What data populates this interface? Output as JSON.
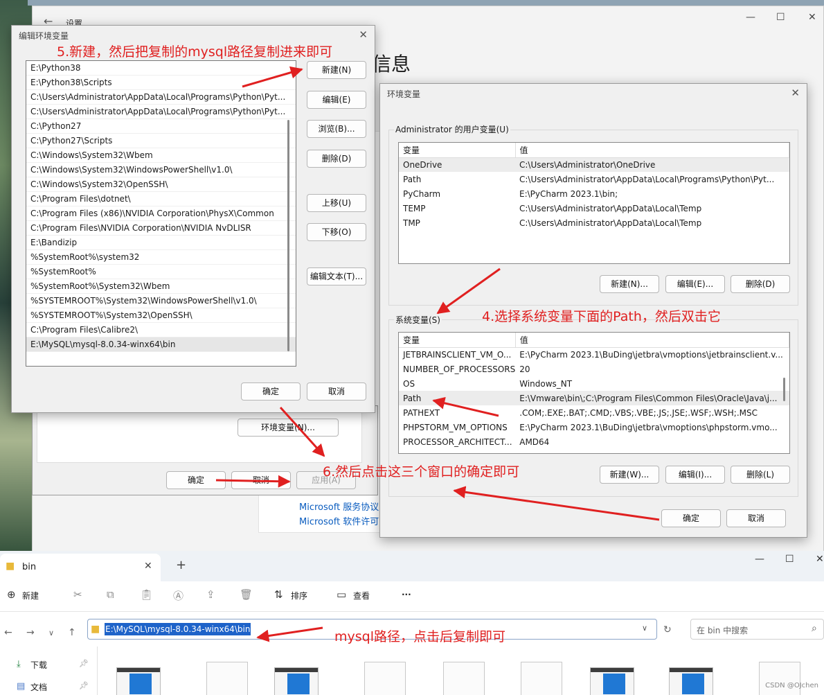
{
  "settings": {
    "title": "设置",
    "back_icon": "back-arrow-icon",
    "heading": "信息",
    "env_button": "环境变量(N)...",
    "ok": "确定",
    "cancel": "取消",
    "apply": "应用(A)",
    "links": [
      "Microsoft 服务协议",
      "Microsoft 软件许可"
    ]
  },
  "edit_env": {
    "title": "编辑环境变量",
    "items": [
      "E:\\Python38",
      "E:\\Python38\\Scripts",
      "C:\\Users\\Administrator\\AppData\\Local\\Programs\\Python\\Pyt...",
      "C:\\Users\\Administrator\\AppData\\Local\\Programs\\Python\\Pyt...",
      "C:\\Python27",
      "C:\\Python27\\Scripts",
      "C:\\Windows\\System32\\Wbem",
      "C:\\Windows\\System32\\WindowsPowerShell\\v1.0\\",
      "C:\\Windows\\System32\\OpenSSH\\",
      "C:\\Program Files\\dotnet\\",
      "C:\\Program Files (x86)\\NVIDIA Corporation\\PhysX\\Common",
      "C:\\Program Files\\NVIDIA Corporation\\NVIDIA NvDLISR",
      "E:\\Bandizip",
      "%SystemRoot%\\system32",
      "%SystemRoot%",
      "%SystemRoot%\\System32\\Wbem",
      "%SYSTEMROOT%\\System32\\WindowsPowerShell\\v1.0\\",
      "%SYSTEMROOT%\\System32\\OpenSSH\\",
      "C:\\Program Files\\Calibre2\\",
      "E:\\MySQL\\mysql-8.0.34-winx64\\bin"
    ],
    "buttons": {
      "new": "新建(N)",
      "edit": "编辑(E)",
      "browse": "浏览(B)...",
      "delete": "删除(D)",
      "up": "上移(U)",
      "down": "下移(O)",
      "edit_text": "编辑文本(T)..."
    },
    "ok": "确定",
    "cancel": "取消"
  },
  "env_vars": {
    "title": "环境变量",
    "user_group": "Administrator 的用户变量(U)",
    "col_var": "变量",
    "col_val": "值",
    "user_rows": [
      {
        "name": "OneDrive",
        "value": "C:\\Users\\Administrator\\OneDrive"
      },
      {
        "name": "Path",
        "value": "C:\\Users\\Administrator\\AppData\\Local\\Programs\\Python\\Pyt..."
      },
      {
        "name": "PyCharm",
        "value": "E:\\PyCharm 2023.1\\bin;"
      },
      {
        "name": "TEMP",
        "value": "C:\\Users\\Administrator\\AppData\\Local\\Temp"
      },
      {
        "name": "TMP",
        "value": "C:\\Users\\Administrator\\AppData\\Local\\Temp"
      }
    ],
    "user_buttons": {
      "new": "新建(N)...",
      "edit": "编辑(E)...",
      "delete": "删除(D)"
    },
    "system_group": "系统变量(S)",
    "system_rows": [
      {
        "name": "JETBRAINSCLIENT_VM_O...",
        "value": "E:\\PyCharm 2023.1\\BuDing\\jetbra\\vmoptions\\jetbrainsclient.v..."
      },
      {
        "name": "NUMBER_OF_PROCESSORS",
        "value": "20"
      },
      {
        "name": "OS",
        "value": "Windows_NT"
      },
      {
        "name": "Path",
        "value": "E:\\Vmware\\bin\\;C:\\Program Files\\Common Files\\Oracle\\Java\\j..."
      },
      {
        "name": "PATHEXT",
        "value": ".COM;.EXE;.BAT;.CMD;.VBS;.VBE;.JS;.JSE;.WSF;.WSH;.MSC"
      },
      {
        "name": "PHPSTORM_VM_OPTIONS",
        "value": "E:\\PyCharm 2023.1\\BuDing\\jetbra\\vmoptions\\phpstorm.vmo..."
      },
      {
        "name": "PROCESSOR_ARCHITECT...",
        "value": "AMD64"
      }
    ],
    "system_buttons": {
      "new": "新建(W)...",
      "edit": "编辑(I)...",
      "delete": "删除(L)"
    },
    "ok": "确定",
    "cancel": "取消"
  },
  "annotations": {
    "step4": "4.选择系统变量下面的Path，然后双击它",
    "step5": "5.新建，然后把复制的mysql路径复制进来即可",
    "step6": "6.然后点击这三个窗口的确定即可",
    "mysql_path": "mysql路径，点击后复制即可"
  },
  "explorer": {
    "tab_label": "bin",
    "new_label": "新建",
    "sort_label": "排序",
    "view_label": "查看",
    "more_label": "···",
    "address": "E:\\MySQL\\mysql-8.0.34-winx64\\bin",
    "search_placeholder": "在 bin 中搜索",
    "sidebar": [
      "下载",
      "文档"
    ]
  },
  "watermark": "CSDN @OJchen",
  "colors": {
    "annotation": "#e02020",
    "accent": "#2078d4",
    "selection": "#1e63c9"
  }
}
